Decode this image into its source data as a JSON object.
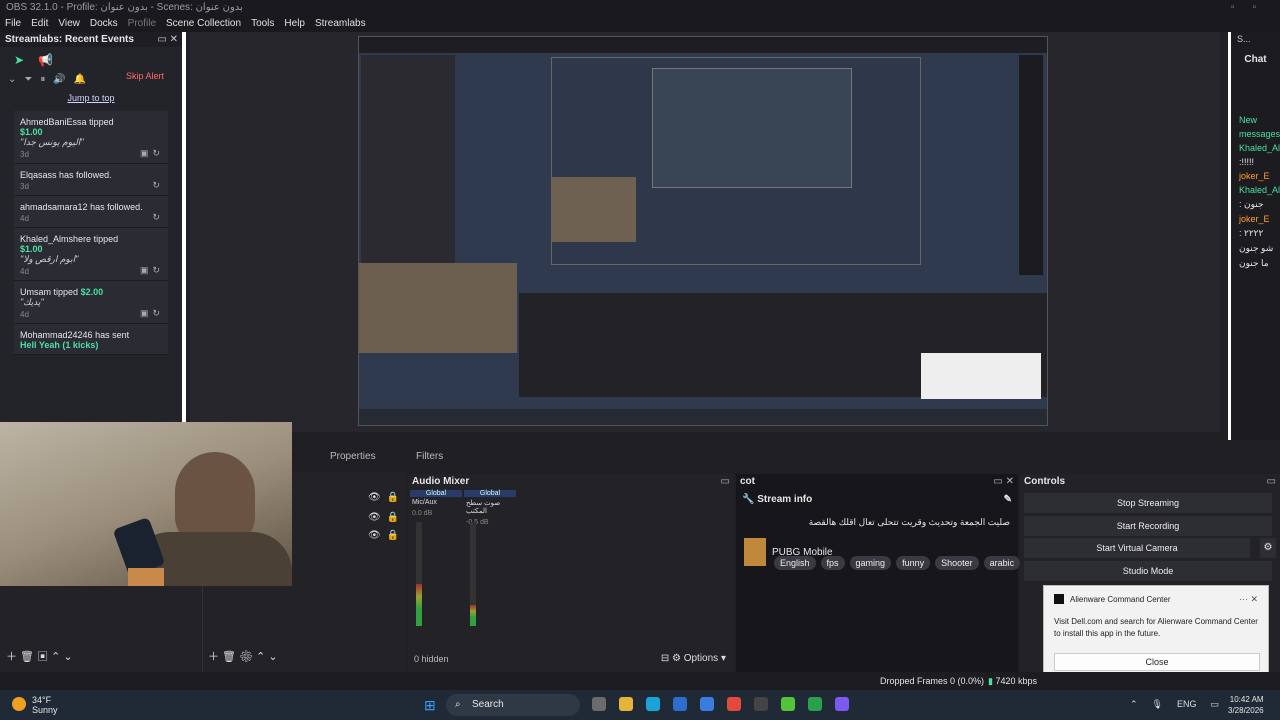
{
  "titlebar": {
    "title": "OBS 32.1.0 - Profile: بدون عنوان - Scenes: بدون عنوان"
  },
  "menu": [
    "File",
    "Edit",
    "View",
    "Docks",
    "Profile",
    "Scene Collection",
    "Tools",
    "Help",
    "Streamlabs"
  ],
  "events_dock": {
    "title": "Streamlabs: Recent Events",
    "skip_alert": "Skip Alert",
    "jump_to_top": "Jump to top",
    "events": [
      {
        "who": "AhmedBaniEssa",
        "action": "tipped",
        "amount": "$1.00",
        "message": "\"اليوم يونس جدا\"",
        "time": "3d"
      },
      {
        "who": "Elqasass",
        "action": "has followed.",
        "amount": "",
        "message": "",
        "time": "3d"
      },
      {
        "who": "ahmadsamara12",
        "action": "has followed.",
        "amount": "",
        "message": "",
        "time": "4d"
      },
      {
        "who": "Khaled_Almshere",
        "action": "tipped",
        "amount": "$1.00",
        "message": "\"ابوم ارقص ولا\"",
        "time": "4d"
      },
      {
        "who": "Umsam",
        "action": "tipped",
        "amount": "$2.00",
        "message": "\"يديك\"",
        "time": "4d"
      },
      {
        "who": "Mohammad24246",
        "action": "has sent",
        "amount": "Hell Yeah (1 kicks)",
        "message": "",
        "time": ""
      }
    ]
  },
  "chat_dock": {
    "header": "S...",
    "title": "Chat",
    "lines": [
      {
        "text": "New",
        "color": "green"
      },
      {
        "text": "messages",
        "color": "green"
      },
      {
        "text": "Khaled_Al",
        "color": "green"
      },
      {
        "text": ":!!!!!",
        "color": "white"
      },
      {
        "text": "joker_E",
        "color": "orange"
      },
      {
        "text": "Khaled_Al",
        "color": "green"
      },
      {
        "text": ": جنون",
        "color": "white"
      },
      {
        "text": "joker_E",
        "color": "orange"
      },
      {
        "text": ": ٢٢٢٢",
        "color": "white"
      },
      {
        "text": "شو جنون",
        "color": "white"
      },
      {
        "text": "ما جنون",
        "color": "white"
      }
    ]
  },
  "tabs": {
    "properties": "Properties",
    "filters": "Filters"
  },
  "mixer": {
    "title": "Audio Mixer",
    "channels": [
      {
        "label": "Global",
        "device": "Mic/Aux",
        "db": "0.0 dB",
        "level": 0.4
      },
      {
        "label": "Global",
        "device": "صوت سطح المكتب",
        "db": "-0.5 dB",
        "level": 0.2
      }
    ],
    "hidden": "0 hidden",
    "options": "Options"
  },
  "cot": {
    "title": "cot",
    "stream_info": "Stream info",
    "stream_title": "صليت الجمعة وتحديث وقريت تتحلى تعال اقلك هالقصة",
    "game": "PUBG Mobile",
    "tags": [
      "English",
      "fps",
      "gaming",
      "funny",
      "Shooter",
      "arabic"
    ]
  },
  "controls": {
    "title": "Controls",
    "buttons": [
      "Stop Streaming",
      "Start Recording",
      "Start Virtual Camera",
      "Studio Mode"
    ]
  },
  "popup": {
    "title": "Alienware Command Center",
    "body": "Visit Dell.com and search for Alienware Command Center to install this app in the future.",
    "close": "Close"
  },
  "status": {
    "dropped": "Dropped Frames 0 (0.0%)",
    "kbps": "7420 kbps"
  },
  "taskbar": {
    "temp": "34°F",
    "weather": "Sunny",
    "search": "Search",
    "lang": "ENG",
    "time": "10:42 AM",
    "date": "3/28/2026"
  }
}
